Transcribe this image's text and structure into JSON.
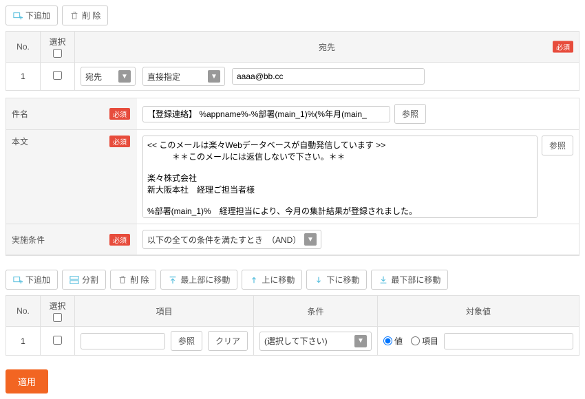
{
  "toolbar1": {
    "addBelow": "下追加",
    "delete": "削 除"
  },
  "destTable": {
    "headers": {
      "no": "No.",
      "select": "選択",
      "dest": "宛先"
    },
    "requiredBadge": "必須",
    "row": {
      "no": "1",
      "toType": "宛先",
      "specType": "直接指定",
      "email": "aaaa@bb.cc"
    }
  },
  "form": {
    "subjectLabel": "件名",
    "subjectValue": "【登録連絡】 %appname%-%部署(main_1)%(%年月(main_",
    "browseBtn": "参照",
    "bodyLabel": "本文",
    "bodyValue": "<< このメールは楽々Webデータベースが自動発信しています >>\n　　　＊＊このメールには返信しないで下さい。＊＊\n\n楽々株式会社\n新大阪本社　経理ご担当者様\n\n%部署(main_1)%　経理担当により、今月の集計結果が登録されました。\n以下のURLよりご確認をお願いいたします。",
    "condLabel": "実施条件",
    "condValue": "以下の全ての条件を満たすとき　（AND）",
    "requiredBadge": "必須"
  },
  "toolbar2": {
    "addBelow": "下追加",
    "split": "分割",
    "delete": "削 除",
    "moveTop": "最上部に移動",
    "moveUp": "上に移動",
    "moveDown": "下に移動",
    "moveBottom": "最下部に移動"
  },
  "condTable": {
    "headers": {
      "no": "No.",
      "select": "選択",
      "item": "項目",
      "cond": "条件",
      "target": "対象値"
    },
    "row": {
      "no": "1",
      "browseBtn": "参照",
      "clearBtn": "クリア",
      "condSelect": "(選択して下さい)",
      "radioValue": "値",
      "radioItem": "項目"
    }
  },
  "applyBtn": "適用"
}
